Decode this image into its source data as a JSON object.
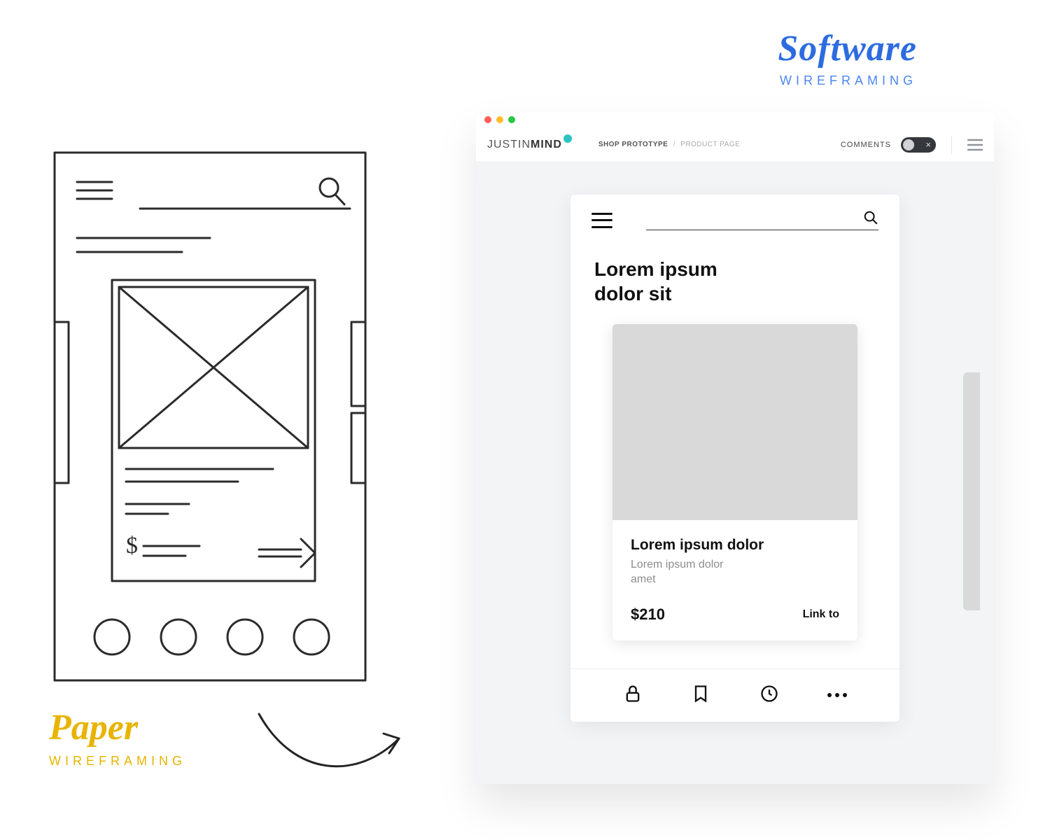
{
  "labels": {
    "software_title": "Software",
    "software_sub": "WIREFRAMING",
    "paper_title": "Paper",
    "paper_sub": "WIREFRAMING"
  },
  "toolbar": {
    "brand_light": "JUSTIN",
    "brand_bold": "MIND",
    "crumb1": "SHOP PROTOTYPE",
    "crumb_sep": "/",
    "crumb2": "PRODUCT PAGE",
    "comments_label": "COMMENTS"
  },
  "prototype": {
    "heading": "Lorem ipsum dolor sit",
    "card_title": "Lorem ipsum dolor",
    "card_sub": "Lorem ipsum dolor amet",
    "price": "$210",
    "link": "Link to"
  }
}
